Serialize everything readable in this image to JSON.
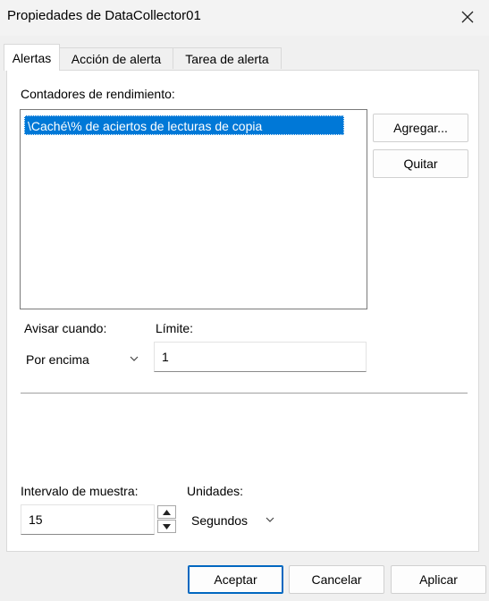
{
  "window": {
    "title": "Propiedades de DataCollector01"
  },
  "tabs": [
    {
      "label": "Alertas"
    },
    {
      "label": "Acción de alerta"
    },
    {
      "label": "Tarea de alerta"
    }
  ],
  "alerts": {
    "counters_label": "Contadores de rendimiento:",
    "counters": [
      "\\Caché\\% de aciertos de lecturas de copia"
    ],
    "add_button": "Agregar...",
    "remove_button": "Quitar",
    "alert_when_label": "Avisar cuando:",
    "alert_when_value": "Por encima",
    "limit_label": "Límite:",
    "limit_value": "1",
    "sample_interval_label": "Intervalo de muestra:",
    "sample_interval_value": "15",
    "units_label": "Unidades:",
    "units_value": "Segundos"
  },
  "footer": {
    "ok": "Aceptar",
    "cancel": "Cancelar",
    "apply": "Aplicar"
  },
  "colors": {
    "selection": "#0078d7",
    "default_button_border": "#0067c0",
    "dialog_background": "#f0f0f0"
  },
  "icons": {
    "close": "close-icon",
    "dropdown": "chevron-down-icon",
    "spin_up": "arrow-up-icon",
    "spin_down": "arrow-down-icon"
  }
}
